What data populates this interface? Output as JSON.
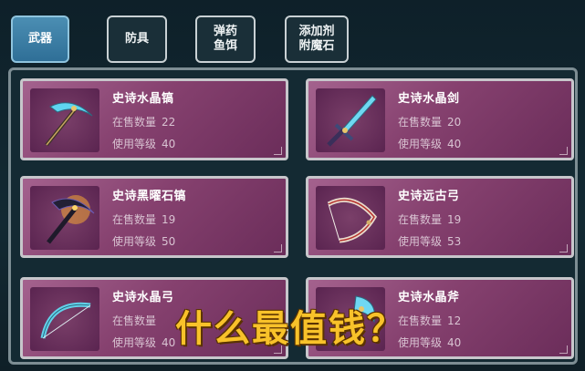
{
  "tabs": [
    {
      "label": "武器",
      "active": true
    },
    {
      "label": "防具",
      "active": false
    },
    {
      "label": "弹药\n鱼饵",
      "active": false
    },
    {
      "label": "添加剂\n附魔石",
      "active": false
    }
  ],
  "items": [
    {
      "name": "史诗水晶镐",
      "stock_label": "在售数量",
      "stock": "22",
      "level_label": "使用等级",
      "level": "40",
      "icon": "crystal-pickaxe-icon"
    },
    {
      "name": "史诗水晶剑",
      "stock_label": "在售数量",
      "stock": "20",
      "level_label": "使用等级",
      "level": "40",
      "icon": "crystal-sword-icon"
    },
    {
      "name": "史诗黑曜石镐",
      "stock_label": "在售数量",
      "stock": "19",
      "level_label": "使用等级",
      "level": "50",
      "icon": "obsidian-pickaxe-icon"
    },
    {
      "name": "史诗远古弓",
      "stock_label": "在售数量",
      "stock": "19",
      "level_label": "使用等级",
      "level": "53",
      "icon": "ancient-bow-icon"
    },
    {
      "name": "史诗水晶弓",
      "stock_label": "在售数量",
      "stock": "",
      "level_label": "使用等级",
      "level": "40",
      "icon": "crystal-bow-icon"
    },
    {
      "name": "史诗水晶斧",
      "stock_label": "在售数量",
      "stock": "12",
      "level_label": "使用等级",
      "level": "40",
      "icon": "crystal-axe-icon"
    }
  ],
  "overlay_caption": "什么最值钱？",
  "colors": {
    "card": "#86416f",
    "tab_active": "#3a7ea6",
    "caption": "#f8c22a"
  }
}
